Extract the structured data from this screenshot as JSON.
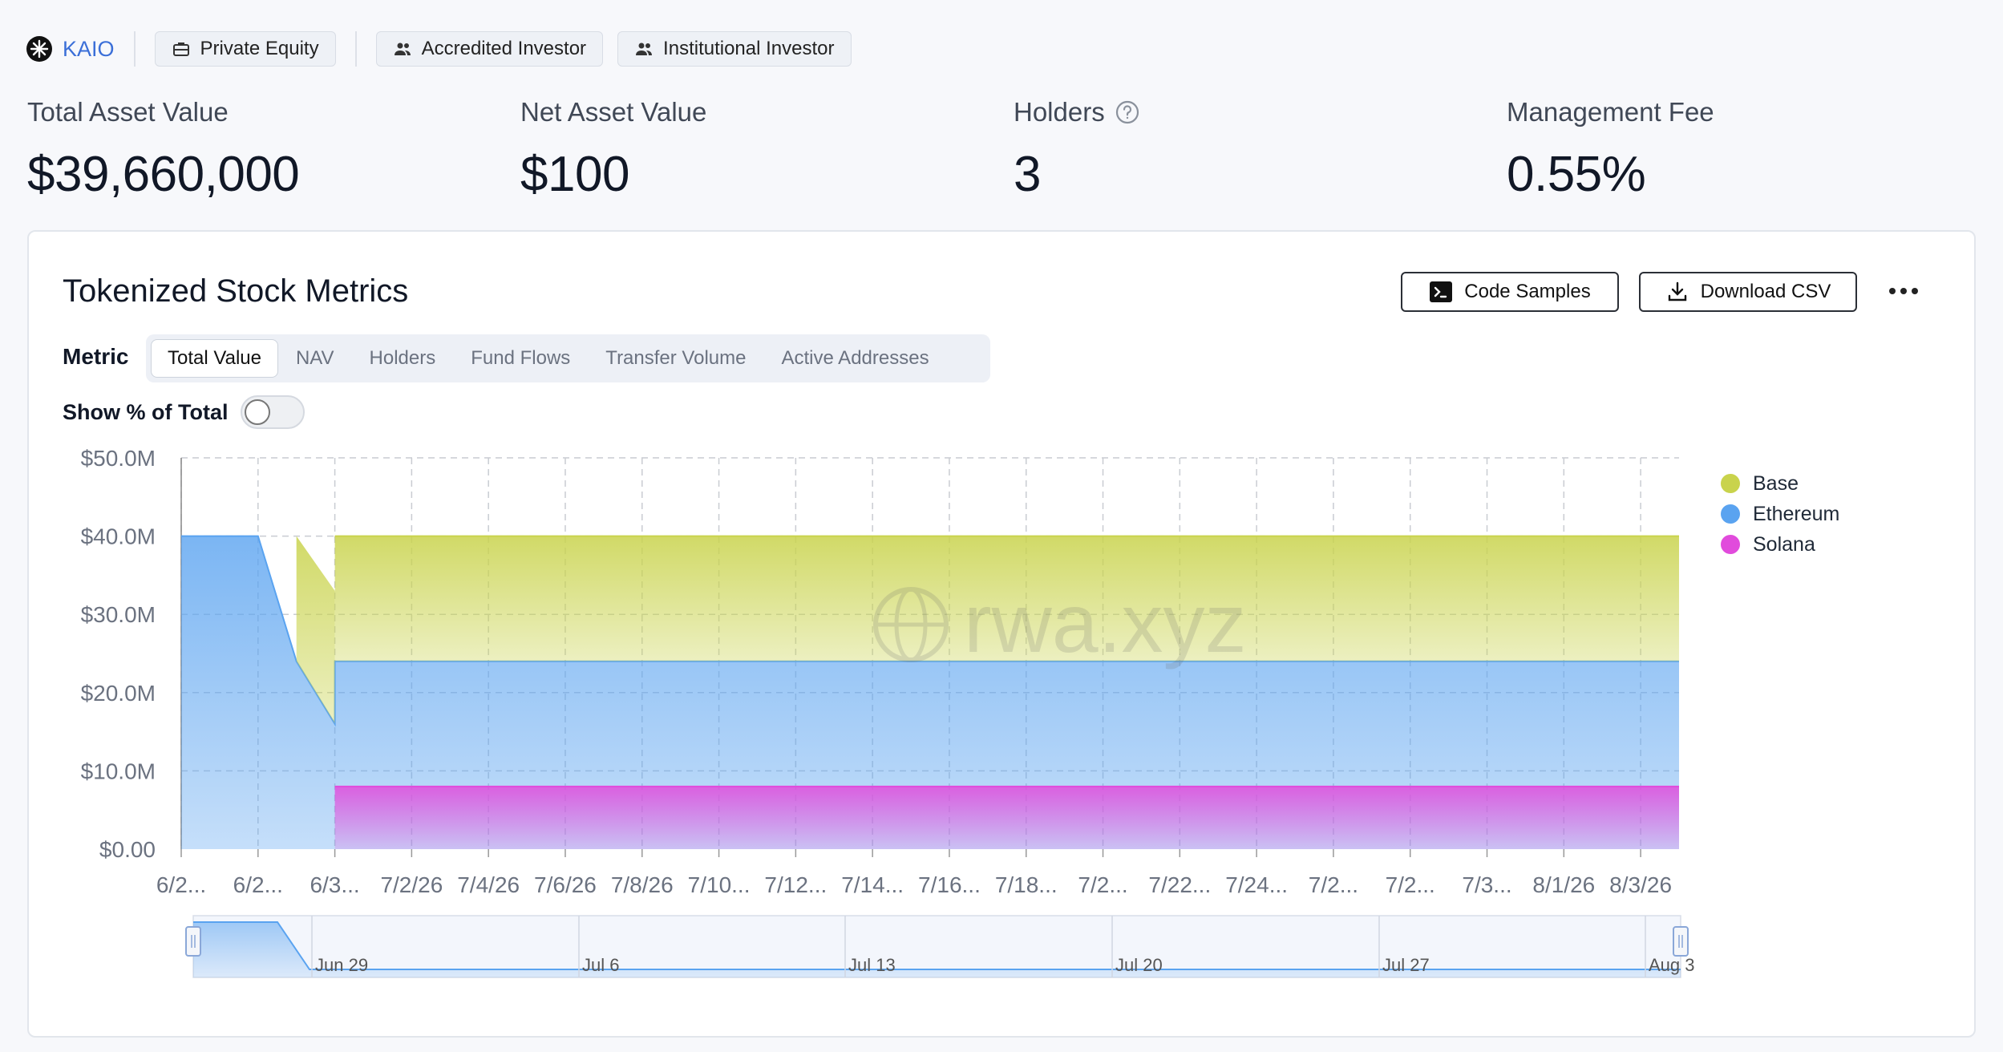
{
  "header": {
    "brand": "KAIO",
    "tags": [
      "Private Equity",
      "Accredited Investor",
      "Institutional Investor"
    ]
  },
  "stats": [
    {
      "label": "Total Asset Value",
      "value": "$39,660,000"
    },
    {
      "label": "Net Asset Value",
      "value": "$100"
    },
    {
      "label": "Holders",
      "value": "3"
    },
    {
      "label": "Management Fee",
      "value": "0.55%"
    }
  ],
  "card": {
    "title": "Tokenized Stock Metrics",
    "code_samples_label": "Code Samples",
    "download_label": "Download CSV",
    "metric_label": "Metric",
    "tabs": [
      "Total Value",
      "NAV",
      "Holders",
      "Fund Flows",
      "Transfer Volume",
      "Active Addresses"
    ],
    "active_tab": "Total Value",
    "toggle_label": "Show % of Total",
    "toggle_on": false
  },
  "colors": {
    "base": "#c9d34c",
    "ethereum": "#5aa3f0",
    "solana": "#e14bdc",
    "accent": "#3b6fd8"
  },
  "chart_data": {
    "type": "area",
    "stacked": true,
    "watermark": "rwa.xyz",
    "y_ticks": [
      "$0.00",
      "$10.0M",
      "$20.0M",
      "$30.0M",
      "$40.0M",
      "$50.0M"
    ],
    "ylim": [
      0,
      50
    ],
    "y_unit": "M USD",
    "x_tick_labels": [
      "6/2...",
      "6/2...",
      "6/3...",
      "7/2/26",
      "7/4/26",
      "7/6/26",
      "7/8/26",
      "7/10...",
      "7/12...",
      "7/14...",
      "7/16...",
      "7/18...",
      "7/2...",
      "7/22...",
      "7/24...",
      "7/2...",
      "7/2...",
      "7/3...",
      "8/1/26",
      "8/3/26"
    ],
    "x_index": [
      0,
      1,
      1.5,
      2,
      19.5
    ],
    "series": [
      {
        "name": "Ethereum",
        "values": [
          40,
          40,
          24,
          16,
          24
        ],
        "x_index_override": [
          0,
          1,
          1.5,
          2,
          2,
          19.5
        ],
        "values_full": [
          40,
          40,
          24,
          16,
          24,
          24
        ]
      },
      {
        "name": "Base",
        "values": [
          0,
          0,
          16,
          17,
          16
        ],
        "values_full": [
          0,
          0,
          16,
          17,
          16,
          16
        ]
      },
      {
        "name": "Solana",
        "values": [
          0,
          0,
          0,
          0,
          8
        ],
        "values_full": [
          0,
          0,
          0,
          0,
          8,
          8
        ]
      }
    ],
    "legend": {
      "placement": "right",
      "items": [
        "Base",
        "Ethereum",
        "Solana"
      ]
    },
    "grid": true,
    "navigator_labels": [
      "Jun 29",
      "Jul 6",
      "Jul 13",
      "Jul 20",
      "Jul 27",
      "Aug 3"
    ]
  }
}
